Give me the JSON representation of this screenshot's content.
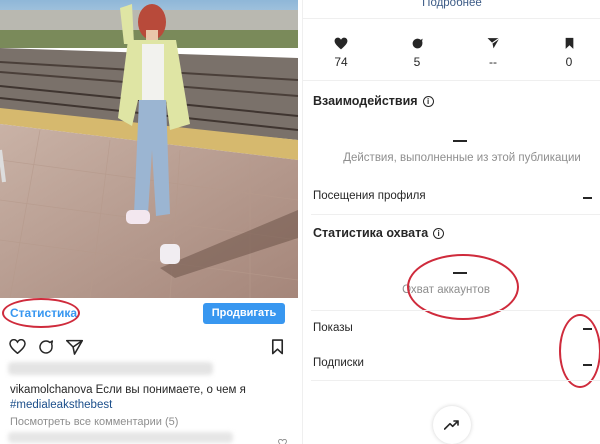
{
  "left_post": {
    "stats_link": "Статистика",
    "promote_button": "Продвигать",
    "username": "vikamolchanova",
    "caption_text": "Если вы понимаете, о чем я",
    "hashtag": "#medialeaksthebest",
    "comments_link": "Посмотреть все комментарии (5)",
    "icons": [
      "heart-outline-icon",
      "comment-icon",
      "share-icon",
      "bookmark-outline-icon"
    ]
  },
  "right_stats": {
    "more_link": "Подробнее",
    "metrics": [
      {
        "icon": "heart-icon",
        "value": "74"
      },
      {
        "icon": "comment-icon",
        "value": "5"
      },
      {
        "icon": "send-icon",
        "value": "--"
      },
      {
        "icon": "bookmark-icon",
        "value": "0"
      }
    ],
    "interactions": {
      "title": "Взаимодействия",
      "caption": "Действия, выполненные из этой публикации",
      "profile_visits_label": "Посещения профиля"
    },
    "reach": {
      "title": "Статистика охвата",
      "caption": "Охват аккаунтов",
      "impressions_label": "Показы",
      "follows_label": "Подписки"
    }
  },
  "colors": {
    "accent_blue": "#3897f0",
    "annotation_red": "#cf2b3c"
  }
}
